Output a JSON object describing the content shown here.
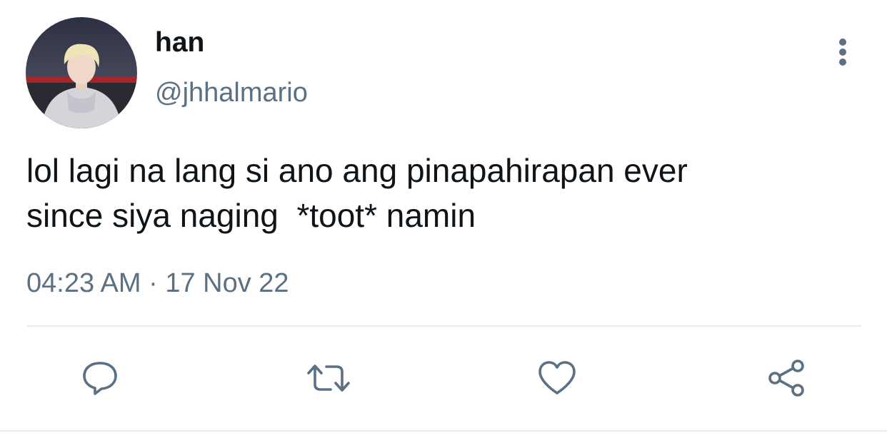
{
  "user": {
    "display_name": "han",
    "handle": "@jhhalmario"
  },
  "tweet": {
    "line1": "lol lagi na lang si ano ang pinapahirapan ever",
    "line2": "since siya naging  *toot* namin",
    "timestamp": "04:23 AM · 17 Nov 22"
  },
  "icons": {
    "more": "more-vertical-icon",
    "reply": "reply-icon",
    "retweet": "retweet-icon",
    "like": "heart-icon",
    "share": "share-icon"
  },
  "colors": {
    "text": "#0f1419",
    "secondary": "#5b7083",
    "accent": "#1da1f2",
    "divider": "#e6ecf0"
  }
}
